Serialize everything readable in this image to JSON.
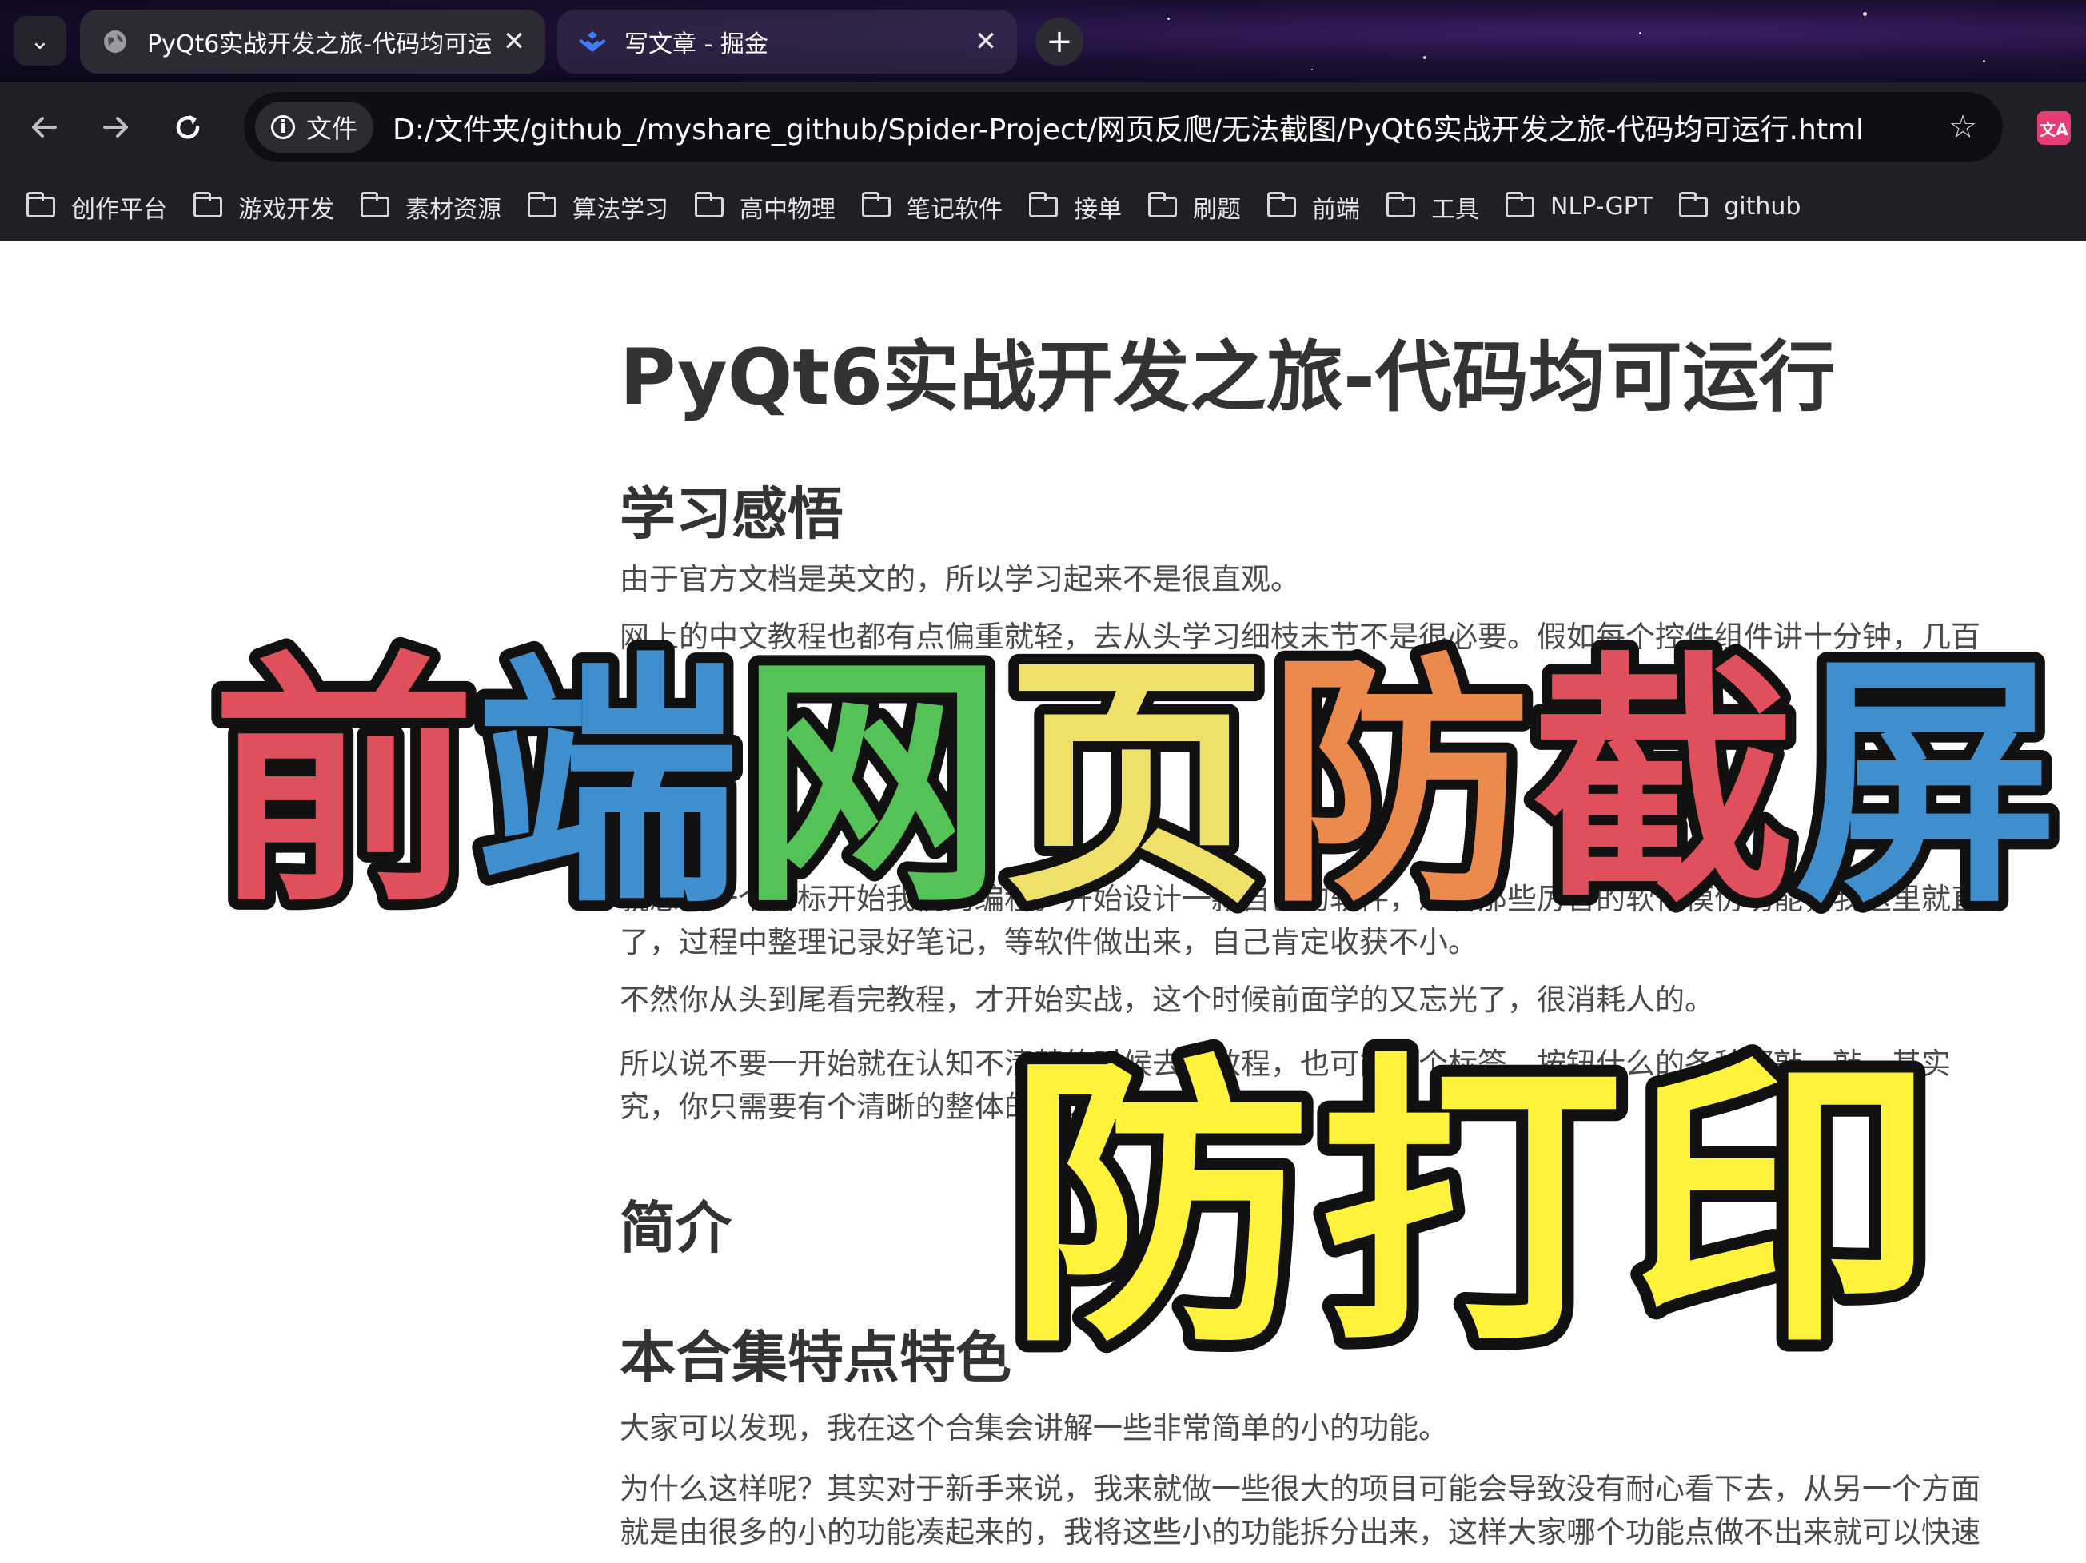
{
  "browser": {
    "tabs": [
      {
        "title": "PyQt6实战开发之旅-代码均可运",
        "active": true,
        "favicon": "globe-icon"
      },
      {
        "title": "写文章 - 掘金",
        "active": false,
        "favicon": "juejin-icon"
      }
    ],
    "close_glyph": "✕",
    "new_tab_glyph": "+",
    "menu_glyph": "⌄",
    "site_info_label": "文件",
    "url": "D:/文件夹/github_/myshare_github/Spider-Project/网页反爬/无法截图/PyQt6实战开发之旅-代码均可运行.html",
    "bookmarks": [
      "创作平台",
      "游戏开发",
      "素材资源",
      "算法学习",
      "高中物理",
      "笔记软件",
      "接单",
      "刷题",
      "前端",
      "工具",
      "NLP-GPT",
      "github"
    ],
    "extension_label": "文A"
  },
  "article": {
    "title": "PyQt6实战开发之旅-代码均可运行",
    "sections": [
      {
        "heading": "学习感悟",
        "paragraphs": [
          "由于官方文档是英文的，所以学习起来不是很直观。",
          "网上的中文教程也都有点偏重就轻，去从头学习细枝末节不是很必要。假如每个控件组件讲十分钟，几百",
          "就想着一个目标开始我们的编程。开始设计一款自己的软件，想着那些厉害的软件模仿功能，我这里就直",
          "了，过程中整理记录好笔记，等软件做出来，自己肯定收获不小。",
          "不然你从头到尾看完教程，才开始实战，这个时候前面学的又忘光了，很消耗人的。",
          "所以说不要一开始就在认知不清楚的时候去看教程，也可能看个标签、按钮什么的各种都敲一敲。其实",
          "究，你只需要有个清晰的整体的认识就行了。"
        ]
      },
      {
        "heading": "简介",
        "paragraphs": []
      },
      {
        "heading": "本合集特点特色",
        "paragraphs": [
          "大家可以发现，我在这个合集会讲解一些非常简单的小的功能。",
          "为什么这样呢？其实对于新手来说，我来就做一些很大的项目可能会导致没有耐心看下去，从另一个方面",
          "就是由很多的小的功能凑起来的，我将这些小的功能拆分出来，这样大家哪个功能点做不出来就可以快速"
        ]
      }
    ]
  },
  "overlay": {
    "line1": [
      {
        "char": "前",
        "color": "#e0505c"
      },
      {
        "char": "端",
        "color": "#3f8fcf"
      },
      {
        "char": "网",
        "color": "#54c256"
      },
      {
        "char": "页",
        "color": "#efe06a"
      },
      {
        "char": "防",
        "color": "#ec8a4e"
      },
      {
        "char": "截",
        "color": "#e0505c"
      },
      {
        "char": "屏",
        "color": "#3f8fcf"
      }
    ],
    "line2": [
      {
        "char": "防",
        "color": "#fff23a"
      },
      {
        "char": "打",
        "color": "#fff23a"
      },
      {
        "char": "印",
        "color": "#fff23a"
      }
    ]
  }
}
